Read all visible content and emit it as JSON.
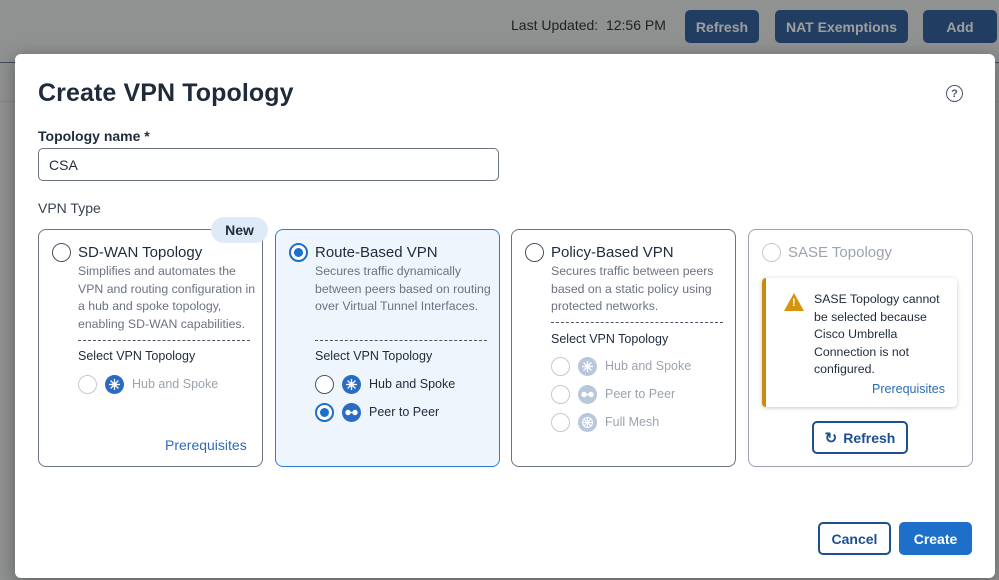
{
  "background": {
    "last_updated_label": "Last Updated:",
    "last_updated_time": "12:56 PM",
    "refresh_label": "Refresh",
    "nat_exemptions_label": "NAT Exemptions",
    "add_label": "Add"
  },
  "modal": {
    "title": "Create VPN Topology",
    "topology_name_label": "Topology name *",
    "topology_name_value": "CSA",
    "vpn_type_label": "VPN Type",
    "new_badge": "New",
    "cards": {
      "sdwan": {
        "title": "SD-WAN Topology",
        "description": "Simplifies and automates the VPN and routing configuration in a hub and spoke topology, enabling SD-WAN capabilities.",
        "select_label": "Select VPN Topology",
        "options": [
          "Hub and Spoke"
        ],
        "prerequisites_label": "Prerequisites"
      },
      "route_based": {
        "title": "Route-Based VPN",
        "description": "Secures traffic dynamically between peers based on routing over Virtual Tunnel Interfaces.",
        "select_label": "Select VPN Topology",
        "options": [
          "Hub and Spoke",
          "Peer to Peer"
        ],
        "selected_option": "Peer to Peer"
      },
      "policy_based": {
        "title": "Policy-Based VPN",
        "description": "Secures traffic between peers based on a static policy using protected networks.",
        "select_label": "Select VPN Topology",
        "options": [
          "Hub and Spoke",
          "Peer to Peer",
          "Full Mesh"
        ]
      },
      "sase": {
        "title": "SASE Topology",
        "warning": "SASE Topology cannot be selected because Cisco Umbrella Connection is not configured.",
        "prerequisites_label": "Prerequisites",
        "refresh_label": "Refresh"
      }
    },
    "selected_vpn_type": "Route-Based VPN",
    "cancel_label": "Cancel",
    "create_label": "Create"
  },
  "colors": {
    "primary": "#1d6fc9",
    "primary_dark": "#1d4f91",
    "selected_card_bg": "#eef5fd",
    "warning": "#c98a0f"
  }
}
